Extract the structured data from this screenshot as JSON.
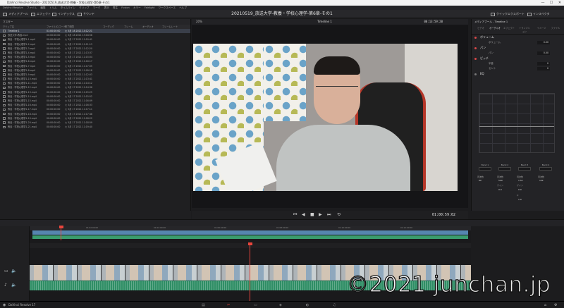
{
  "titlebar": {
    "text": "DaVinci Resolve Studio - 20210519_放送大学-教養・学校心理学-第6章-その1",
    "min": "—",
    "max": "☐",
    "close": "✕"
  },
  "menubar": [
    "DaVinci Resolve",
    "ファイル",
    "編集",
    "トリム",
    "タイムライン",
    "クリップ",
    "マーク",
    "表示",
    "再生",
    "Fusion",
    "カラー",
    "Fairlight",
    "ワークスペース",
    "ヘルプ"
  ],
  "toolbar": {
    "media_pool": "メディアプール",
    "effects": "エフェクト",
    "edit_index": "インデックス",
    "sound": "サウンド",
    "title": "20210519_放送大学-教養・学校心理学-第6章-その1",
    "mixer": "ミキサー",
    "metadata": "メタデータ",
    "inspector": "インスペクタ",
    "quick_export": "クイックエクスポート"
  },
  "media": {
    "header": "マスター",
    "sub": "マスター",
    "columns": [
      "クリップ名",
      "ファイル(C)コード",
      "終了時間",
      "開始日",
      "コーデック",
      "フレーム",
      "オーディオ",
      "フレームレート"
    ],
    "rows": [
      {
        "name": "Timeline 1",
        "tc": "01:00:00:00",
        "date": "火 5月 18 2021 14:12:21"
      },
      {
        "name": "放送大学-教養.mp4",
        "tc": "00:00:00:00",
        "date": "火 5月 18 2021 13:04:58"
      },
      {
        "name": "教養・学校心理学1-1.mp4",
        "tc": "00:00:00:00",
        "date": "火 5月 17 2021 11:10:41"
      },
      {
        "name": "教養・学校心理学1-2.mp4",
        "tc": "00:00:00:00",
        "date": "火 5月 17 2021 11:11:13"
      },
      {
        "name": "教養・学校心理学1-3.mp4",
        "tc": "00:00:00:00",
        "date": "火 5月 17 2021 11:12:20"
      },
      {
        "name": "教養・学校心理学1-4.mp4",
        "tc": "00:00:00:00",
        "date": "火 5月 17 2021 11:13:37"
      },
      {
        "name": "教養・学校心理学1-5.mp4",
        "tc": "00:00:00:00",
        "date": "火 5月 17 2021 11:15:04"
      },
      {
        "name": "教養・学校心理学1-6.mp4",
        "tc": "00:00:00:00",
        "date": "火 5月 17 2021 11:16:17"
      },
      {
        "name": "教養・学校心理学1-7.mp4",
        "tc": "00:00:00:00",
        "date": "火 5月 17 2021 11:17:05"
      },
      {
        "name": "教養・学校心理学1-8.mp4",
        "tc": "00:00:00:00",
        "date": "火 5月 17 2021 11:09:18"
      },
      {
        "name": "教養・学校心理学1-9.mp4",
        "tc": "00:00:00:00",
        "date": "火 5月 17 2021 11:12:03"
      },
      {
        "name": "教養・学校心理学1-10.mp4",
        "tc": "00:00:00:00",
        "date": "火 5月 17 2021 11:13:41"
      },
      {
        "name": "教養・学校心理学1-11.mp4",
        "tc": "00:00:00:00",
        "date": "火 5月 17 2021 11:14:12"
      },
      {
        "name": "教養・学校心理学1-12.mp4",
        "tc": "00:00:00:00",
        "date": "火 5月 17 2021 11:14:36"
      },
      {
        "name": "教養・学校心理学1-13.mp4",
        "tc": "00:00:00:00",
        "date": "火 5月 17 2021 11:15:25"
      },
      {
        "name": "教養・学校心理学1-14.mp4",
        "tc": "00:00:00:00",
        "date": "火 5月 17 2021 11:15:52"
      },
      {
        "name": "教養・学校心理学1-15.mp4",
        "tc": "00:00:00:00",
        "date": "火 5月 17 2021 11:16:09"
      },
      {
        "name": "教養・学校心理学1-16.mp4",
        "tc": "00:00:00:00",
        "date": "火 5月 17 2021 11:16:33"
      },
      {
        "name": "教養・学校心理学1-17.mp4",
        "tc": "00:00:00:00",
        "date": "火 5月 17 2021 11:17:11"
      },
      {
        "name": "教養・学校心理学1-18.mp4",
        "tc": "00:00:00:00",
        "date": "火 5月 17 2021 11:17:48"
      },
      {
        "name": "教養・学校心理学1-19.mp4",
        "tc": "00:00:00:00",
        "date": "火 5月 17 2021 11:18:22"
      },
      {
        "name": "教養・学校心理学1-20.mp4",
        "tc": "00:00:00:00",
        "date": "火 5月 17 2021 11:18:59"
      },
      {
        "name": "教養・学校心理学1-21.mp4",
        "tc": "00:00:00:00",
        "date": "火 5月 17 2021 11:19:40"
      }
    ]
  },
  "viewer": {
    "timeline_name": "Timeline 1",
    "zoom": "20%",
    "timecode_top": "00:13:59:20",
    "timecode": "01:00:59:02"
  },
  "inspector": {
    "header": "メディアプール - Timeline 1",
    "tabs": [
      "ビデオ",
      "オーディオ",
      "エフェクト",
      "トランジション",
      "イメージ",
      "ファイル"
    ],
    "volume_label": "ボリューム",
    "volume_field": "ボリューム",
    "volume_value": "0.00",
    "pan_label": "パン",
    "pan_field": "パン",
    "pan_value": "0.00",
    "pitch_label": "ピッチ",
    "pitch_semi": "半音",
    "pitch_semi_value": "0",
    "pitch_cent": "セント",
    "pitch_cent_value": "0",
    "eq_label": "EQ",
    "bands": [
      "Band 1",
      "Band 2",
      "Band 3",
      "Band 4"
    ],
    "band_fields": [
      [
        "周波数",
        "80"
      ],
      [
        "周波数",
        "500"
      ],
      [
        "周波数",
        "1.5k"
      ],
      [
        "周波数",
        "10k"
      ]
    ],
    "gain_label": "ゲイン",
    "gain_values": [
      "0.0",
      "0.0"
    ],
    "q_label": "Q",
    "q_value": "1.0"
  },
  "timeline": {
    "ruler_marks": [
      "01:00:00:00",
      "01:02:00:00",
      "01:04:00:00",
      "01:06:00:00",
      "01:08:00:00",
      "01:10:00:00",
      "01:12:00:00"
    ]
  },
  "statusbar": {
    "app": "DaVinci Resolve 17"
  },
  "watermark": "©2021 junchan.jp"
}
